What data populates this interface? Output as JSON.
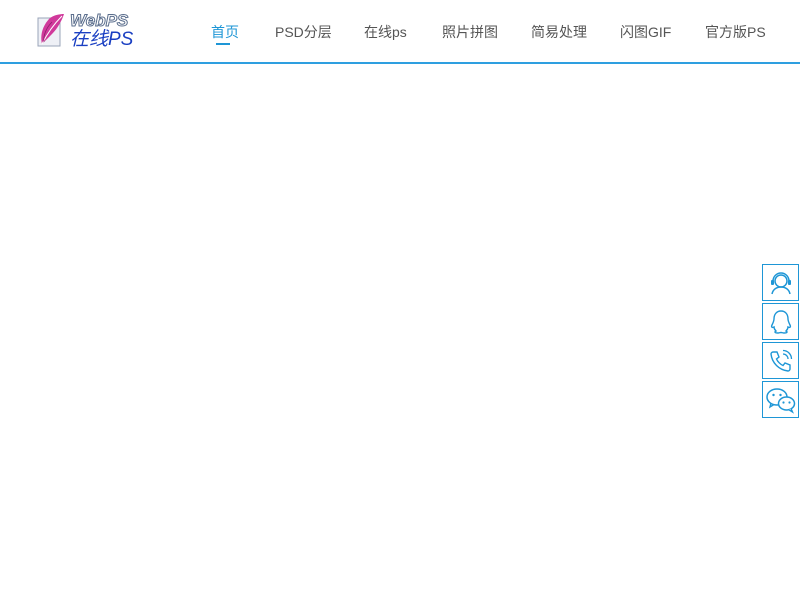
{
  "logo": {
    "line1": "WebPS",
    "line2": "在线PS"
  },
  "nav": {
    "items": [
      {
        "label": "首页",
        "active": true
      },
      {
        "label": "PSD分层",
        "active": false
      },
      {
        "label": "在线ps",
        "active": false
      },
      {
        "label": "照片拼图",
        "active": false
      },
      {
        "label": "简易处理",
        "active": false
      },
      {
        "label": "闪图GIF",
        "active": false
      },
      {
        "label": "官方版PS",
        "active": false
      }
    ]
  },
  "sidebar": {
    "buttons": [
      {
        "icon": "customer-service-icon"
      },
      {
        "icon": "qq-icon"
      },
      {
        "icon": "phone-icon"
      },
      {
        "icon": "wechat-icon"
      }
    ]
  },
  "colors": {
    "accent": "#1e96d6",
    "header_border": "#2e9fe0",
    "nav_text": "#555555",
    "logo_text": "#1a3fc2"
  }
}
